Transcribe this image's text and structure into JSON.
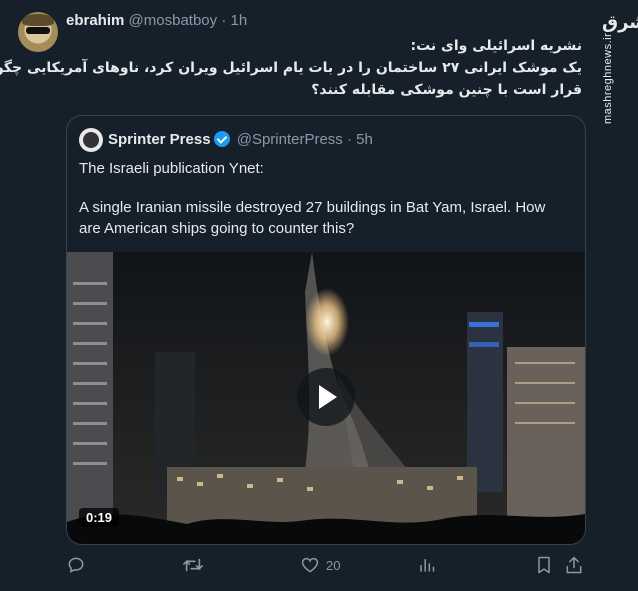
{
  "tweet": {
    "author_name": "ebrahim",
    "author_handle": "@mosbatboy",
    "separator": "·",
    "time": "1h",
    "text_lines": [
      "نشریه اسرائیلی وای نت:",
      "یک موشک ایرانی ۲۷ ساختمان را در بات یام اسرائیل ویران کرد، ناوهای آمریکایی چگونه",
      "قرار است با چنین موشکی مقابله کنند؟"
    ]
  },
  "watermark": {
    "logo_text": "مشرق",
    "url": "mashreghnews.ir"
  },
  "quoted": {
    "name": "Sprinter Press",
    "handle": "@SprinterPress",
    "separator": "·",
    "time": "5h",
    "line1": "The Israeli publication Ynet:",
    "line2": "A single Iranian missile destroyed 27 buildings in Bat Yam, Israel. How",
    "line3": "are American ships going to counter this?",
    "video_duration": "0:19"
  },
  "actions": {
    "reply_icon": "reply-icon",
    "retweet_icon": "retweet-icon",
    "like_icon": "like-icon",
    "like_count": "20",
    "views_icon": "views-icon",
    "bookmark_icon": "bookmark-icon",
    "share_icon": "share-icon"
  },
  "colors": {
    "background": "#15202b",
    "text": "#e7e9ea",
    "muted": "#8b98a5",
    "border": "#38444d",
    "verified": "#1d9bf0"
  }
}
